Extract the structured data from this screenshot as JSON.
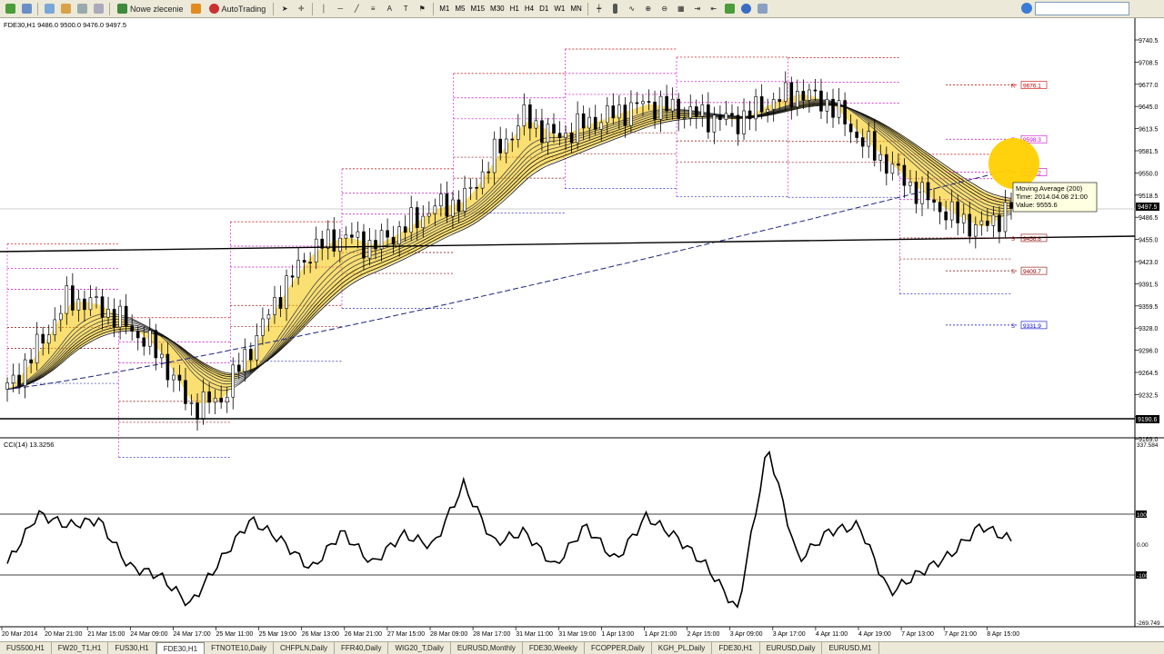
{
  "toolbar": {
    "new_order_label": "Nowe zlecenie",
    "autotrading_label": "AutoTrading",
    "timeframes": [
      "M1",
      "M5",
      "M15",
      "M30",
      "H1",
      "H4",
      "D1",
      "W1",
      "MN"
    ]
  },
  "chart": {
    "header": "FDE30,H1  9486.0 9500.0 9476.0 9497.5",
    "price_axis": [
      "9740.5",
      "9708.5",
      "9677.0",
      "9645.0",
      "9613.5",
      "9581.5",
      "9550.0",
      "9518.5",
      "9486.5",
      "9455.0",
      "9423.0",
      "9391.5",
      "9359.5",
      "9328.0",
      "9296.0",
      "9264.5",
      "9232.5",
      "9201.0",
      "9169.0"
    ],
    "current_price": "9497.5",
    "bottom_line_label": "9190.6",
    "pivot_levels": [
      {
        "tag": "R",
        "value": "9676.1",
        "color": "#cc0000"
      },
      {
        "tag": "R",
        "value": "9598.3",
        "color": "#cc00cc"
      },
      {
        "tag": "R",
        "value": "9551.2",
        "color": "#cc00cc"
      },
      {
        "tag": "S",
        "value": "9456.8",
        "color": "#8b0000"
      },
      {
        "tag": "S",
        "value": "9409.7",
        "color": "#8b0000"
      },
      {
        "tag": "S",
        "value": "9331.9",
        "color": "#0000cc"
      }
    ],
    "tooltip": {
      "line1": "Moving Average (200)",
      "line2": "Time: 2014.04.08 21:00",
      "line3": "Value: 9555.6"
    }
  },
  "cci": {
    "header": "CCI(14) 13.3256",
    "axis": [
      "337.584",
      "100",
      "0.00",
      "-100",
      "-269.749"
    ]
  },
  "time_axis": [
    "20 Mar 2014",
    "20 Mar 21:00",
    "21 Mar 15:00",
    "24 Mar 09:00",
    "24 Mar 17:00",
    "25 Mar 11:00",
    "25 Mar 19:00",
    "26 Mar 13:00",
    "26 Mar 21:00",
    "27 Mar 15:00",
    "28 Mar 09:00",
    "28 Mar 17:00",
    "31 Mar 11:00",
    "31 Mar 19:00",
    "1 Apr 13:00",
    "1 Apr 21:00",
    "2 Apr 15:00",
    "3 Apr 09:00",
    "3 Apr 17:00",
    "4 Apr 11:00",
    "4 Apr 19:00",
    "7 Apr 13:00",
    "7 Apr 21:00",
    "8 Apr 15:00"
  ],
  "tabs": [
    "FUS500,H1",
    "FW20_T1,H1",
    "FUS30,H1",
    "FDE30,H1",
    "FTNOTE10,Daily",
    "CHFPLN,Daily",
    "FFR40,Daily",
    "WIG20_T,Daily",
    "EURUSD,Monthly",
    "FDE30,Weekly",
    "FCOPPER,Daily",
    "KGH_PL,Daily",
    "FDE30,H1",
    "EURUSD,Daily",
    "EURUSD,M1"
  ],
  "active_tab": 3,
  "colors": {
    "ribbon": "#f5c400",
    "ma200": "#1a237e",
    "pivot_red": "#cc0000",
    "pivot_blue": "#3333cc"
  },
  "chart_data": {
    "type": "line",
    "series": [
      {
        "values": [
          9240,
          9300,
          9370,
          9360,
          9330,
          9290,
          9215,
          9225,
          9300,
          9380,
          9440,
          9460,
          9445,
          9470,
          9500,
          9510,
          9575,
          9630,
          9600,
          9620,
          9635,
          9650,
          9640,
          9630,
          9625,
          9650,
          9665,
          9650,
          9600,
          9560,
          9520,
          9490,
          9470,
          9500
        ]
      },
      {
        "values": [
          -70,
          100,
          60,
          80,
          -80,
          -110,
          -210,
          -60,
          80,
          10,
          -90,
          40,
          -70,
          30,
          -10,
          200,
          0,
          40,
          -80,
          60,
          -60,
          90,
          20,
          -80,
          -230,
          330,
          -60,
          40,
          60,
          -170,
          -100,
          -40,
          60,
          10
        ]
      }
    ]
  }
}
